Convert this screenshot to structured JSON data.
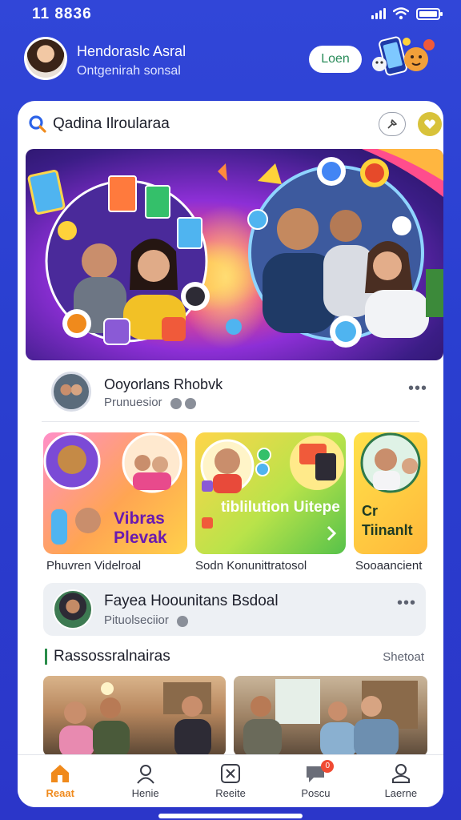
{
  "status_bar": {
    "time": "11 8836"
  },
  "header": {
    "title": "Hendoraslc Asral",
    "subtitle": "Ontgenirah sonsal",
    "login_label": "Loen"
  },
  "search": {
    "text": "Qadina Ilroularaa"
  },
  "post": {
    "title": "Ooyorlans Rhobvk",
    "subtitle": "Prunuesior"
  },
  "tiles": [
    {
      "title": "Vibras Plevak",
      "label": "Phuvren Videlroal"
    },
    {
      "title": "tiblilution Uitepe",
      "label": "Sodn Konunittratosol"
    },
    {
      "title": "Cr Tiinanlt",
      "label": "Sooaancient"
    }
  ],
  "feature": {
    "title": "Fayea Hoounitans Bsdoal",
    "subtitle": "Pituolseciior"
  },
  "section": {
    "title": "Rassossralnairas",
    "link": "Shetoat"
  },
  "bottom_nav": [
    {
      "label": "Reaat",
      "icon": "home-icon",
      "active": true
    },
    {
      "label": "Henie",
      "icon": "person-icon",
      "active": false
    },
    {
      "label": "Reeite",
      "icon": "share-icon",
      "active": false
    },
    {
      "label": "Poscu",
      "icon": "chat-icon",
      "active": false,
      "badge": "0"
    },
    {
      "label": "Laerne",
      "icon": "profile-icon",
      "active": false
    }
  ],
  "colors": {
    "background": "#3146d8",
    "accent_orange": "#f08a1c",
    "login_text": "#2a8c5a",
    "badge_red": "#f04a32"
  }
}
